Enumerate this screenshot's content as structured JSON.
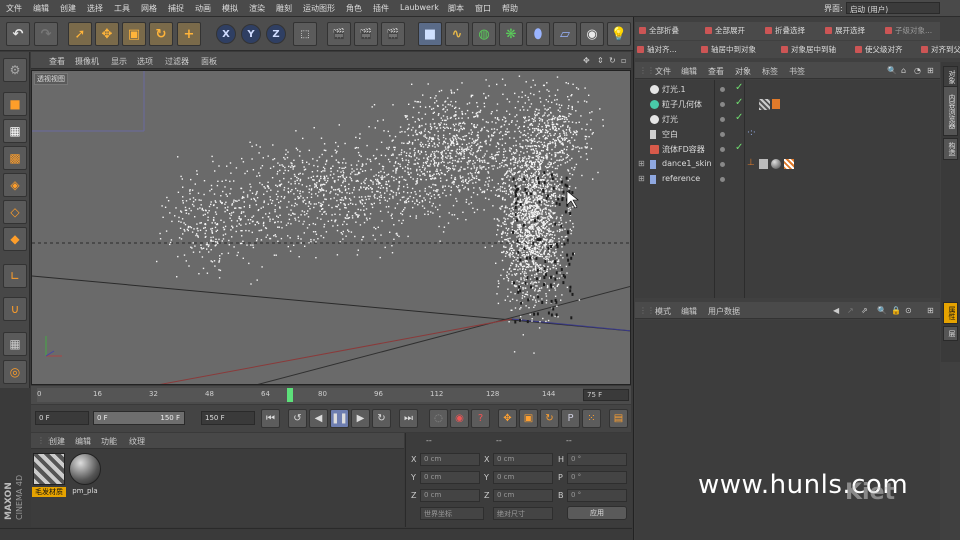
{
  "menubar": {
    "items": [
      "文件",
      "编辑",
      "创建",
      "选择",
      "工具",
      "网格",
      "捕捉",
      "动画",
      "模拟",
      "渲染",
      "雕刻",
      "运动图形",
      "角色",
      "插件",
      "Laubwerk",
      "脚本",
      "窗口",
      "帮助"
    ],
    "layout_label": "界面:",
    "layout_value": "启动 (用户)"
  },
  "viewport": {
    "menu": [
      "查看",
      "摄像机",
      "显示",
      "选项",
      "过滤器",
      "面板"
    ],
    "label": "透视视图"
  },
  "timeline": {
    "ticks": [
      "0",
      "16",
      "32",
      "48",
      "64",
      "80",
      "96",
      "112",
      "128",
      "144"
    ],
    "current_frame": 72,
    "end_field": "75 F"
  },
  "transport": {
    "start": "0 F",
    "range_start": "0 F",
    "range_end": "150 F",
    "end": "150 F"
  },
  "materials": {
    "menu": [
      "创建",
      "编辑",
      "功能",
      "纹理"
    ],
    "items": [
      {
        "label": "毛发材质"
      },
      {
        "label": "pm_pla"
      }
    ]
  },
  "coords": {
    "headers": [
      "--",
      "--",
      "--"
    ],
    "rows": [
      {
        "a": "X",
        "av": "0 cm",
        "b": "X",
        "bv": "0 cm",
        "c": "H",
        "cv": "0 °"
      },
      {
        "a": "Y",
        "av": "0 cm",
        "b": "Y",
        "bv": "0 cm",
        "c": "P",
        "cv": "0 °"
      },
      {
        "a": "Z",
        "av": "0 cm",
        "b": "Z",
        "bv": "0 cm",
        "c": "B",
        "cv": "0 °"
      }
    ],
    "mode1": "世界坐标",
    "mode2": "绝对尺寸",
    "apply": "应用"
  },
  "object_toolbar": {
    "row1": [
      "全部折叠",
      "全部展开",
      "折叠选择",
      "展开选择",
      "子级对象..."
    ],
    "row2": [
      "轴对齐...",
      "轴居中到对象",
      "对象居中到轴",
      "使父级对齐",
      "对齐到父"
    ]
  },
  "object_manager": {
    "menu": [
      "文件",
      "编辑",
      "查看",
      "对象",
      "标签",
      "书签"
    ],
    "objects": [
      {
        "name": "灯光.1",
        "icon_color": "#e6e6e6",
        "checked": true
      },
      {
        "name": "粒子几何体",
        "icon_color": "#49c9a8",
        "checked": true
      },
      {
        "name": "灯光",
        "icon_color": "#e6e6e6",
        "checked": true
      },
      {
        "name": "空白",
        "icon_color": "#cfcfcf",
        "checked": false
      },
      {
        "name": "流体FD容器",
        "icon_color": "#d85a4a",
        "checked": true
      },
      {
        "name": "dance1_skin",
        "icon_color": "#8fa8e0",
        "checked": false
      },
      {
        "name": "reference",
        "icon_color": "#8fa8e0",
        "checked": false
      }
    ]
  },
  "attributes": {
    "menu": [
      "模式",
      "编辑",
      "用户数据"
    ]
  },
  "side_tabs": [
    "对象",
    "内容浏览器",
    "构造"
  ],
  "side_tabs2": [
    "属性",
    "层"
  ],
  "branding": {
    "maxon": "MAXON",
    "c4d": "CINEMA 4D"
  },
  "watermark": "www.hunls.com",
  "watermark2": "Kiet"
}
